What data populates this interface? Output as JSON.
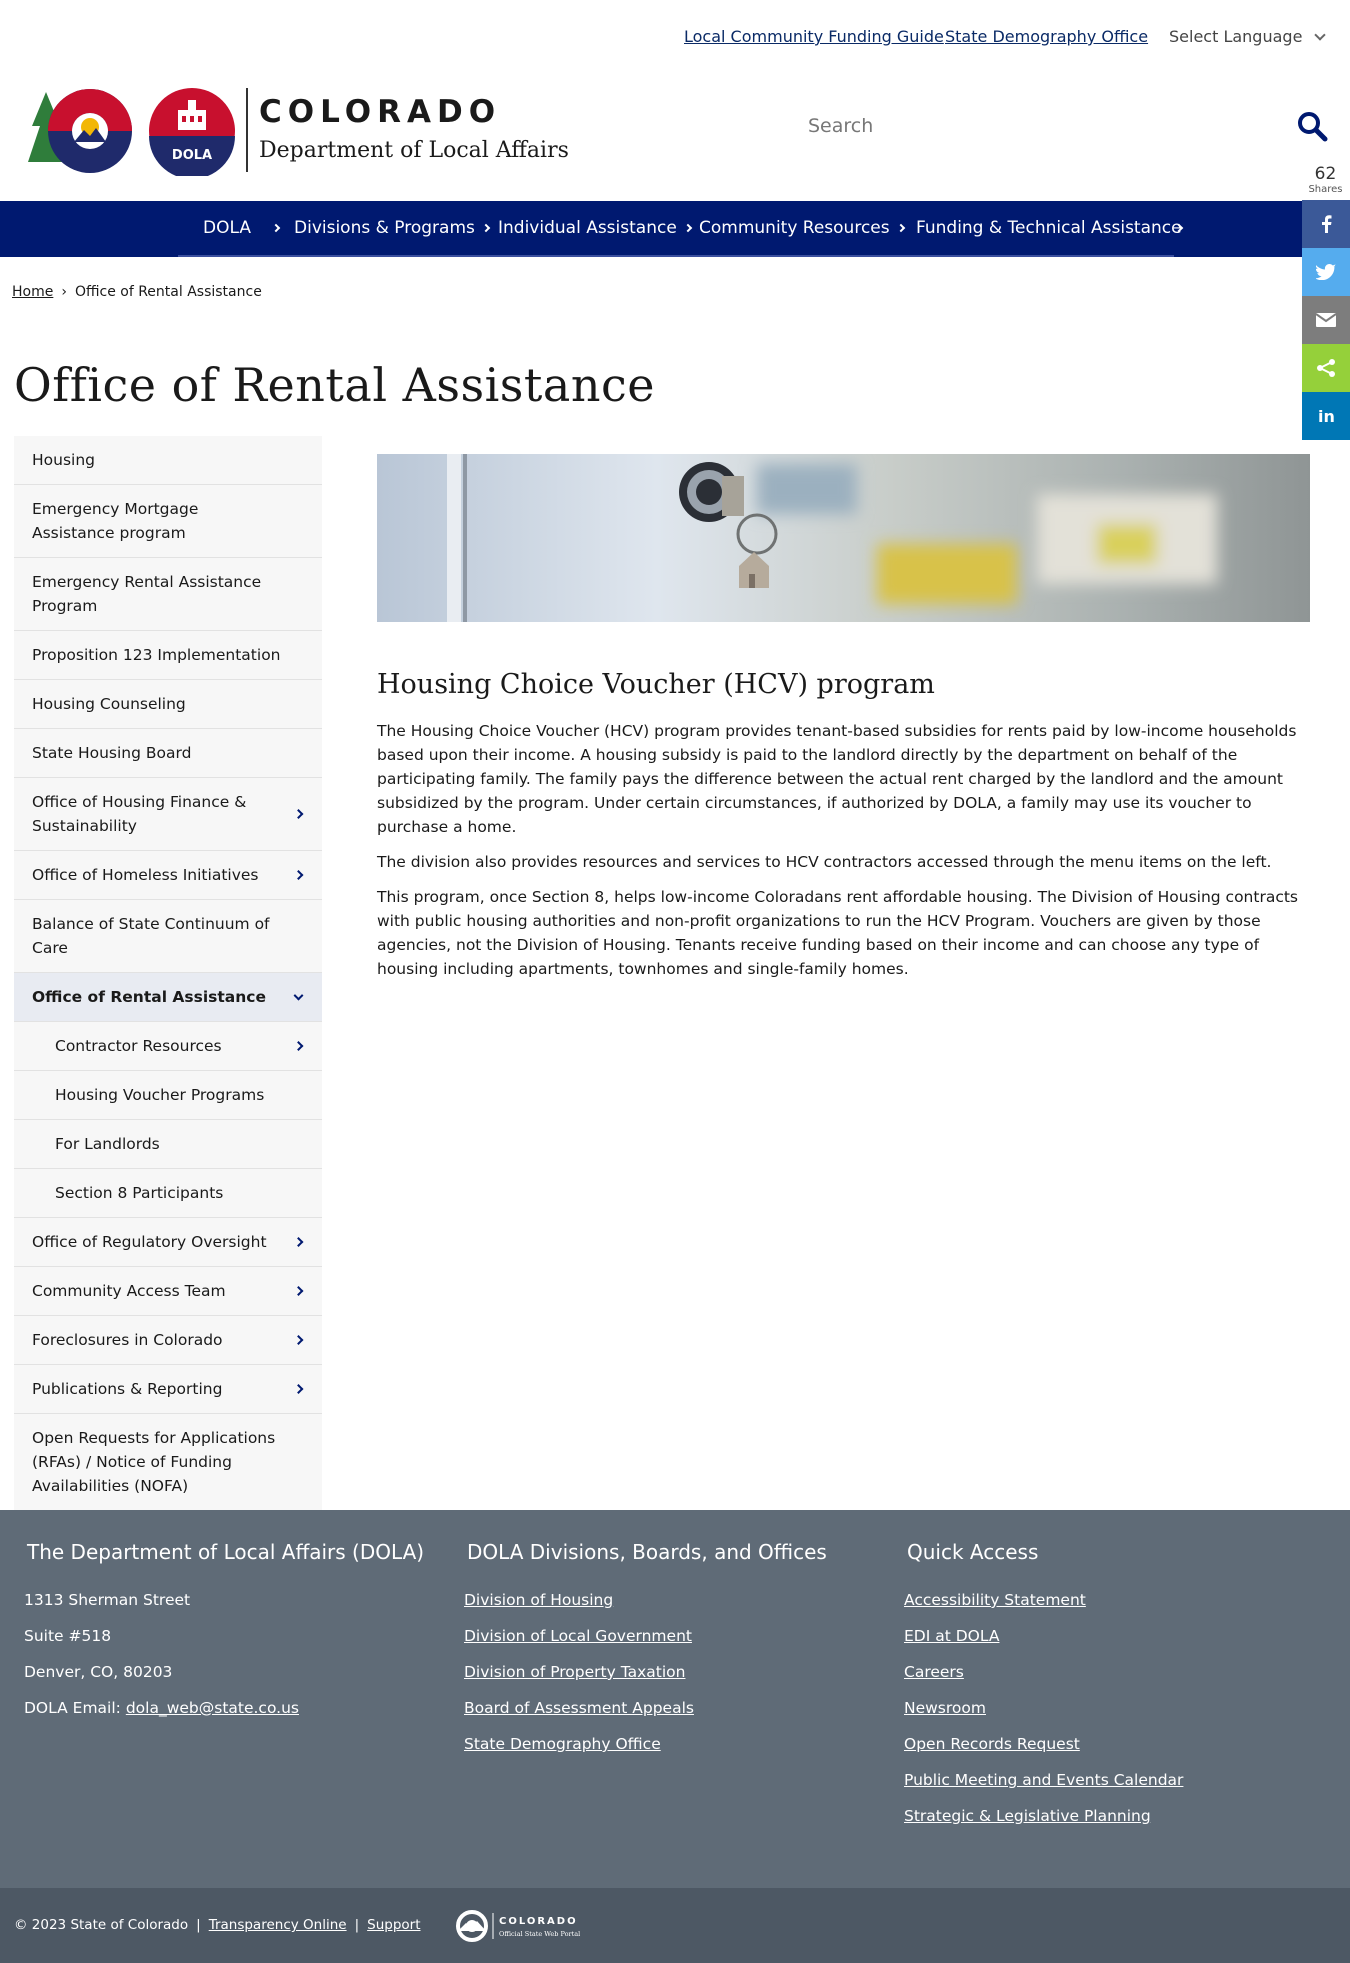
{
  "utility": {
    "link1": "Local Community Funding Guide",
    "link2": "State Demography Office",
    "language": "Select Language"
  },
  "header": {
    "brand_title": "COLORADO",
    "brand_subtitle": "Department of Local Affairs",
    "logo_badge": "DOLA",
    "search_placeholder": "Search"
  },
  "nav": {
    "items": [
      {
        "label": "DOLA"
      },
      {
        "label": "Divisions & Programs"
      },
      {
        "label": "Individual Assistance"
      },
      {
        "label": "Community Resources"
      },
      {
        "label": "Funding & Technical Assistance"
      }
    ]
  },
  "share": {
    "count": "62",
    "label": "Shares",
    "colors": {
      "facebook": "#3b5998",
      "twitter": "#55acee",
      "email": "#7d7d7d",
      "sharethis": "#95d03a",
      "linkedin": "#0077b5"
    }
  },
  "breadcrumb": {
    "home": "Home",
    "separator": "›",
    "current": "Office of Rental Assistance"
  },
  "page_title": "Office of Rental Assistance",
  "sidebar": {
    "items": [
      {
        "label": "Housing"
      },
      {
        "label": "Emergency Mortgage Assistance program"
      },
      {
        "label": "Emergency Rental Assistance Program"
      },
      {
        "label": "Proposition 123 Implementation"
      },
      {
        "label": "Housing Counseling"
      },
      {
        "label": "State Housing Board"
      },
      {
        "label": "Office of Housing Finance & Sustainability"
      },
      {
        "label": "Office of Homeless Initiatives"
      },
      {
        "label": "Balance of State Continuum of Care"
      },
      {
        "label": "Office of Rental Assistance"
      },
      {
        "label": "Contractor Resources"
      },
      {
        "label": "Housing Voucher Programs"
      },
      {
        "label": "For Landlords"
      },
      {
        "label": "Section 8 Participants"
      },
      {
        "label": "Office of Regulatory Oversight"
      },
      {
        "label": "Community Access Team"
      },
      {
        "label": "Foreclosures in Colorado"
      },
      {
        "label": "Publications & Reporting"
      },
      {
        "label": "Open Requests for Applications (RFAs) / Notice of Funding Availabilities (NOFA)"
      }
    ]
  },
  "main": {
    "heading": "Housing Choice Voucher (HCV) program",
    "paragraphs": [
      "The Housing Choice Voucher (HCV) program provides tenant-based subsidies for rents paid by low-income households based upon their income. A housing subsidy is paid to the landlord directly by the department on behalf of the participating family. The family pays the difference between the actual rent charged by the landlord and the amount subsidized by the program. Under certain circumstances, if authorized by DOLA, a family may use its voucher to purchase a home.",
      "The division also provides resources and services to HCV contractors accessed through the menu items on the left.",
      "This program, once Section 8, helps low-income Coloradans rent affordable housing. The Division of Housing contracts with public housing authorities and non-profit organizations to run the HCV Program. Vouchers are given by those agencies, not the Division of Housing. Tenants receive funding based on their income and can choose any type of housing including apartments, townhomes and single-family homes."
    ]
  },
  "footer": {
    "col1": {
      "title": "The Department of Local Affairs (DOLA)",
      "address1": "1313 Sherman Street",
      "address2": "Suite  #518",
      "address3": "Denver, CO, 80203",
      "email_label": "DOLA Email: ",
      "email": "dola_web@state.co.us"
    },
    "col2": {
      "title": "DOLA Divisions, Boards, and Offices",
      "links": [
        {
          "label": "Division of Housing"
        },
        {
          "label": "Division of Local Government"
        },
        {
          "label": "Division of Property Taxation"
        },
        {
          "label": "Board of Assessment Appeals"
        },
        {
          "label": "State Demography Office"
        }
      ]
    },
    "col3": {
      "title": "Quick Access",
      "links": [
        {
          "label": "Accessibility Statement"
        },
        {
          "label": "EDI at DOLA"
        },
        {
          "label": "Careers"
        },
        {
          "label": "Newsroom"
        },
        {
          "label": "Open Records Request"
        },
        {
          "label": "Public Meeting and Events Calendar"
        },
        {
          "label": "Strategic & Legislative Planning"
        }
      ]
    },
    "bottom": {
      "copyright": "© 2023 State of Colorado",
      "sep": "|",
      "transparency": "Transparency Online",
      "support": "Support",
      "portal_title": "COLORADO",
      "portal_sub": "Official State Web Portal"
    }
  }
}
